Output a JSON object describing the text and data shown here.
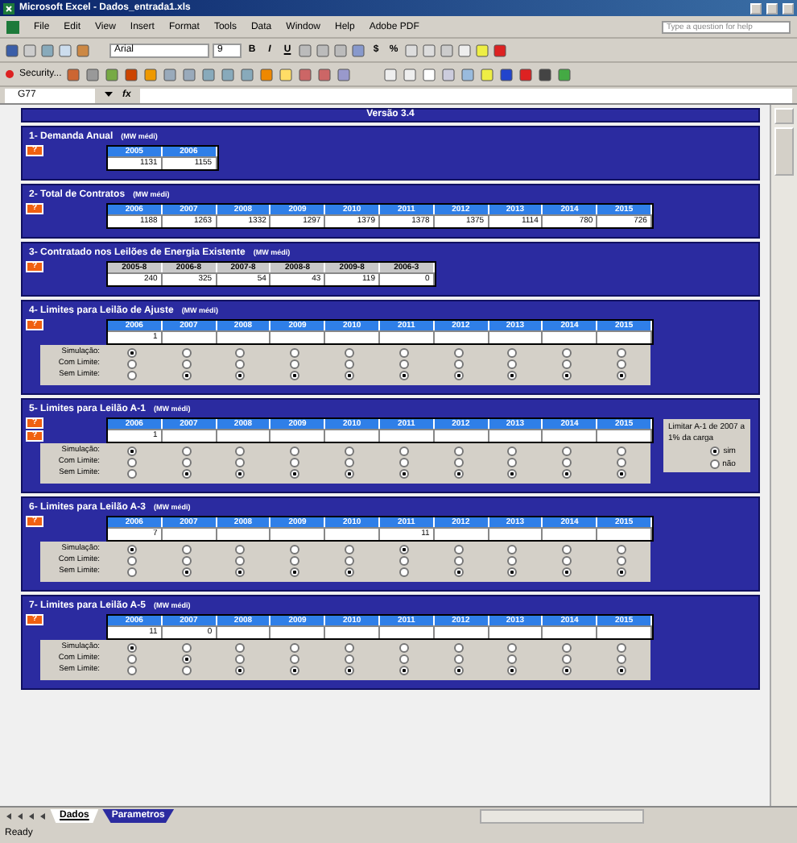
{
  "window": {
    "title": "Microsoft Excel - Dados_entrada1.xls"
  },
  "menu": [
    "File",
    "Edit",
    "View",
    "Insert",
    "Format",
    "Tools",
    "Data",
    "Window",
    "Help",
    "Adobe PDF"
  ],
  "help_box": {
    "placeholder": "Type a question for help"
  },
  "toolbar": {
    "font": "Arial",
    "size": "9",
    "bold": "B",
    "italic": "I",
    "underline": "U",
    "currency": "$",
    "percent": "%",
    "security": "Security..."
  },
  "formula_bar": {
    "cell": "G77",
    "function_label": "fx"
  },
  "sheet": {
    "version": "Versão 3.4",
    "sections": [
      {
        "kind": "values",
        "title": "1- Demanda Anual",
        "unit": "(MW médi)",
        "help": [
          "?"
        ],
        "headers": [
          "2005",
          "2006"
        ],
        "values": [
          "1131",
          "1155"
        ]
      },
      {
        "kind": "values",
        "title": "2- Total de Contratos",
        "unit": "(MW médi)",
        "help": [
          "?"
        ],
        "headers": [
          "2006",
          "2007",
          "2008",
          "2009",
          "2010",
          "2011",
          "2012",
          "2013",
          "2014",
          "2015"
        ],
        "values": [
          "1188",
          "1263",
          "1332",
          "1297",
          "1379",
          "1378",
          "1375",
          "1114",
          "780",
          "726"
        ]
      },
      {
        "kind": "auctions",
        "title": "3- Contratado nos Leilões de Energia Existente",
        "unit": "(MW médi)",
        "help": [
          "?"
        ],
        "headers": [
          "2005-8",
          "2006-8",
          "2007-8",
          "2008-8",
          "2009-8",
          "2006-3"
        ],
        "values": [
          "240",
          "325",
          "54",
          "43",
          "119",
          "0"
        ]
      },
      {
        "kind": "limits",
        "title": "4- Limites para Leilão de Ajuste",
        "unit": "(MW médi)",
        "help": [
          "?"
        ],
        "row_labels": [
          "Simulação:",
          "Com Limite:",
          "Sem Limite:"
        ],
        "columns": [
          {
            "year": "2006",
            "value": "1",
            "radios": [
              {
                "selected": true
              },
              {
                "selected": false
              },
              {
                "selected": false
              }
            ]
          },
          {
            "year": "2007",
            "radios": [
              {
                "selected": false
              },
              {
                "selected": false
              },
              {
                "selected": true
              }
            ]
          },
          {
            "year": "2008",
            "radios": [
              {
                "selected": false
              },
              {
                "selected": false
              },
              {
                "selected": true
              }
            ]
          },
          {
            "year": "2009",
            "radios": [
              {
                "selected": false
              },
              {
                "selected": false
              },
              {
                "selected": true
              }
            ]
          },
          {
            "year": "2010",
            "radios": [
              {
                "selected": false
              },
              {
                "selected": false
              },
              {
                "selected": true
              }
            ]
          },
          {
            "year": "2011",
            "radios": [
              {
                "selected": false
              },
              {
                "selected": false
              },
              {
                "selected": true
              }
            ]
          },
          {
            "year": "2012",
            "radios": [
              {
                "selected": false
              },
              {
                "selected": false
              },
              {
                "selected": true
              }
            ]
          },
          {
            "year": "2013",
            "radios": [
              {
                "selected": false
              },
              {
                "selected": false
              },
              {
                "selected": true
              }
            ]
          },
          {
            "year": "2014",
            "radios": [
              {
                "selected": false
              },
              {
                "selected": false
              },
              {
                "selected": true
              }
            ]
          },
          {
            "year": "2015",
            "radios": [
              {
                "selected": false
              },
              {
                "selected": false
              },
              {
                "selected": true
              }
            ]
          }
        ]
      },
      {
        "kind": "limits",
        "title": "5- Limites para Leilão A-1",
        "unit": "(MW médi)",
        "help": [
          "?",
          "?"
        ],
        "row_labels": [
          "Simulação:",
          "Com Limite:",
          "Sem Limite:"
        ],
        "columns": [
          {
            "year": "2006",
            "value": "1",
            "radios": [
              {
                "selected": true
              },
              {
                "selected": false
              },
              {
                "selected": false
              }
            ]
          },
          {
            "year": "2007",
            "radios": [
              {
                "selected": false
              },
              {
                "selected": false
              },
              {
                "selected": true
              }
            ]
          },
          {
            "year": "2008",
            "radios": [
              {
                "selected": false
              },
              {
                "selected": false
              },
              {
                "selected": true
              }
            ]
          },
          {
            "year": "2009",
            "radios": [
              {
                "selected": false
              },
              {
                "selected": false
              },
              {
                "selected": true
              }
            ]
          },
          {
            "year": "2010",
            "radios": [
              {
                "selected": false
              },
              {
                "selected": false
              },
              {
                "selected": true
              }
            ]
          },
          {
            "year": "2011",
            "radios": [
              {
                "selected": false
              },
              {
                "selected": false
              },
              {
                "selected": true
              }
            ]
          },
          {
            "year": "2012",
            "radios": [
              {
                "selected": false
              },
              {
                "selected": false
              },
              {
                "selected": true
              }
            ]
          },
          {
            "year": "2013",
            "radios": [
              {
                "selected": false
              },
              {
                "selected": false
              },
              {
                "selected": true
              }
            ]
          },
          {
            "year": "2014",
            "radios": [
              {
                "selected": false
              },
              {
                "selected": false
              },
              {
                "selected": true
              }
            ]
          },
          {
            "year": "2015",
            "radios": [
              {
                "selected": false
              },
              {
                "selected": false
              },
              {
                "selected": true
              }
            ]
          }
        ],
        "side_panel": {
          "note": "Limitar A-1 de 2007 a 1% da carga",
          "options": [
            {
              "label": "sim",
              "selected": true
            },
            {
              "label": "não",
              "selected": false
            }
          ]
        }
      },
      {
        "kind": "limits",
        "title": "6- Limites para Leilão A-3",
        "unit": "(MW médi)",
        "help": [
          "?"
        ],
        "row_labels": [
          "Simulação:",
          "Com Limite:",
          "Sem Limite:"
        ],
        "columns": [
          {
            "year": "2006",
            "value": "7",
            "radios": [
              {
                "selected": true
              },
              {
                "selected": false
              },
              {
                "selected": false
              }
            ]
          },
          {
            "year": "2007",
            "radios": [
              {
                "selected": false
              },
              {
                "selected": false
              },
              {
                "selected": true
              }
            ]
          },
          {
            "year": "2008",
            "radios": [
              {
                "selected": false
              },
              {
                "selected": false
              },
              {
                "selected": true
              }
            ]
          },
          {
            "year": "2009",
            "radios": [
              {
                "selected": false
              },
              {
                "selected": false
              },
              {
                "selected": true
              }
            ]
          },
          {
            "year": "2010",
            "radios": [
              {
                "selected": false
              },
              {
                "selected": false
              },
              {
                "selected": true
              }
            ]
          },
          {
            "year": "2011",
            "value": "11",
            "radios": [
              {
                "selected": true
              },
              {
                "selected": false
              },
              {
                "selected": false
              }
            ]
          },
          {
            "year": "2012",
            "radios": [
              {
                "selected": false
              },
              {
                "selected": false
              },
              {
                "selected": true
              }
            ]
          },
          {
            "year": "2013",
            "radios": [
              {
                "selected": false
              },
              {
                "selected": false
              },
              {
                "selected": true
              }
            ]
          },
          {
            "year": "2014",
            "radios": [
              {
                "selected": false
              },
              {
                "selected": false
              },
              {
                "selected": true
              }
            ]
          },
          {
            "year": "2015",
            "radios": [
              {
                "selected": false
              },
              {
                "selected": false
              },
              {
                "selected": true
              }
            ]
          }
        ]
      },
      {
        "kind": "limits",
        "title": "7- Limites para Leilão A-5",
        "unit": "(MW médi)",
        "help": [
          "?"
        ],
        "row_labels": [
          "Simulação:",
          "Com Limite:",
          "Sem Limite:"
        ],
        "columns": [
          {
            "year": "2006",
            "value": "11",
            "radios": [
              {
                "selected": true
              },
              {
                "selected": false
              },
              {
                "selected": false
              }
            ]
          },
          {
            "year": "2007",
            "value": "0",
            "radios": [
              {
                "selected": false
              },
              {
                "selected": true
              },
              {
                "selected": false
              }
            ]
          },
          {
            "year": "2008",
            "radios": [
              {
                "selected": false
              },
              {
                "selected": false
              },
              {
                "selected": true
              }
            ]
          },
          {
            "year": "2009",
            "radios": [
              {
                "selected": false
              },
              {
                "selected": false
              },
              {
                "selected": true
              }
            ]
          },
          {
            "year": "2010",
            "radios": [
              {
                "selected": false
              },
              {
                "selected": false
              },
              {
                "selected": true
              }
            ]
          },
          {
            "year": "2011",
            "radios": [
              {
                "selected": false
              },
              {
                "selected": false
              },
              {
                "selected": true
              }
            ]
          },
          {
            "year": "2012",
            "radios": [
              {
                "selected": false
              },
              {
                "selected": false
              },
              {
                "selected": true
              }
            ]
          },
          {
            "year": "2013",
            "radios": [
              {
                "selected": false
              },
              {
                "selected": false
              },
              {
                "selected": true
              }
            ]
          },
          {
            "year": "2014",
            "radios": [
              {
                "selected": false
              },
              {
                "selected": false
              },
              {
                "selected": true
              }
            ]
          },
          {
            "year": "2015",
            "radios": [
              {
                "selected": false
              },
              {
                "selected": false
              },
              {
                "selected": true
              }
            ]
          }
        ]
      }
    ]
  },
  "sheet_tabs": [
    {
      "label": "Dados",
      "selected": true
    },
    {
      "label": "Parametros",
      "selected": false
    }
  ],
  "status_bar": "Ready"
}
